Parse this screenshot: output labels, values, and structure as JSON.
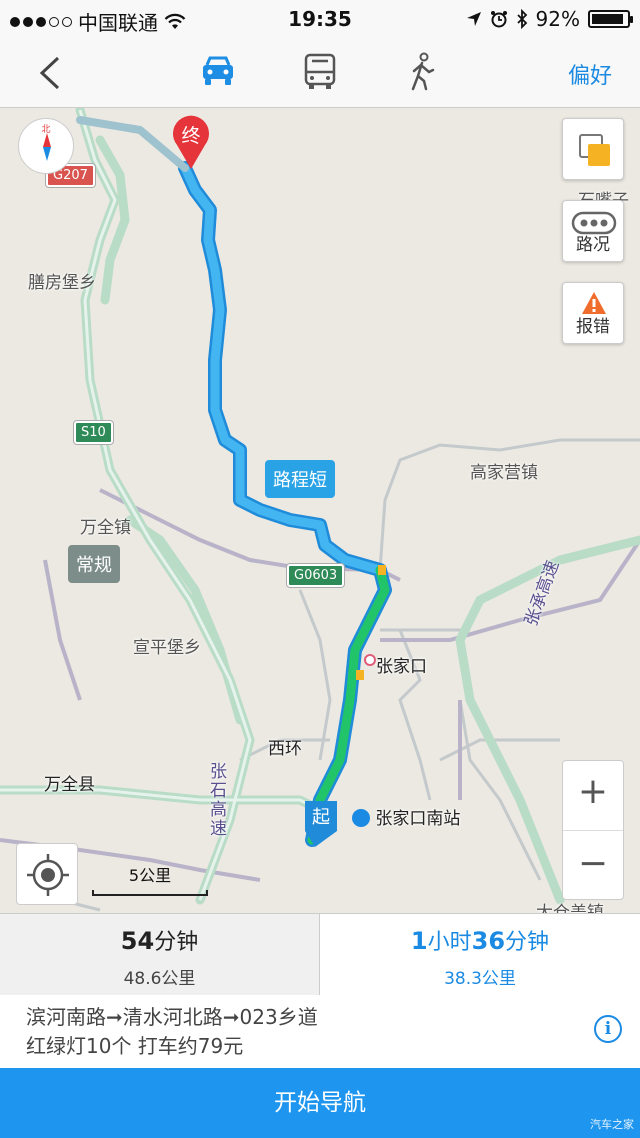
{
  "status": {
    "carrier": "中国联通",
    "time": "19:35",
    "battery": "92%",
    "battery_level": 0.92
  },
  "nav": {
    "modes": [
      "car-icon",
      "bus-icon",
      "walk-icon"
    ],
    "active_mode": "car-icon",
    "preferences": "偏好"
  },
  "map": {
    "labels": {
      "shanfang": "膳房堡乡",
      "wanquan_zhen": "万全镇",
      "xuanping": "宣平堡乡",
      "wanquan_xian": "万全县",
      "gaojiaying": "高家营镇",
      "zhangjiakou": "张家口",
      "xihuan": "西环",
      "zhangshi": "张石高速",
      "zhangcheng": "张承高速",
      "south_station": "张家口南站",
      "shizuizi": "石嘴子",
      "dahezhen": "大仓盖镇"
    },
    "shields": {
      "g207": "G207",
      "s10": "S10",
      "g0603": "G0603"
    },
    "tags": {
      "changgui": "常规",
      "luchengduan": "路程短"
    },
    "pins": {
      "end": "终",
      "start": "起"
    },
    "compass": "北",
    "buttons": {
      "traffic": "路况",
      "report": "报错",
      "zoom_in": "+",
      "zoom_out": "−"
    },
    "scale": "5公里"
  },
  "routes": [
    {
      "time_num": "54",
      "time_unit": "分钟",
      "distance": "48.6公里"
    },
    {
      "h": "1",
      "h_unit": "小时",
      "m": "36",
      "m_unit": "分钟",
      "distance": "38.3公里"
    }
  ],
  "details": {
    "roads": "滨河南路➞清水河北路➞023乡道",
    "extra": "红绿灯10个 打车约79元",
    "info": "i"
  },
  "start_button": "开始导航",
  "watermark": "汽车之家"
}
